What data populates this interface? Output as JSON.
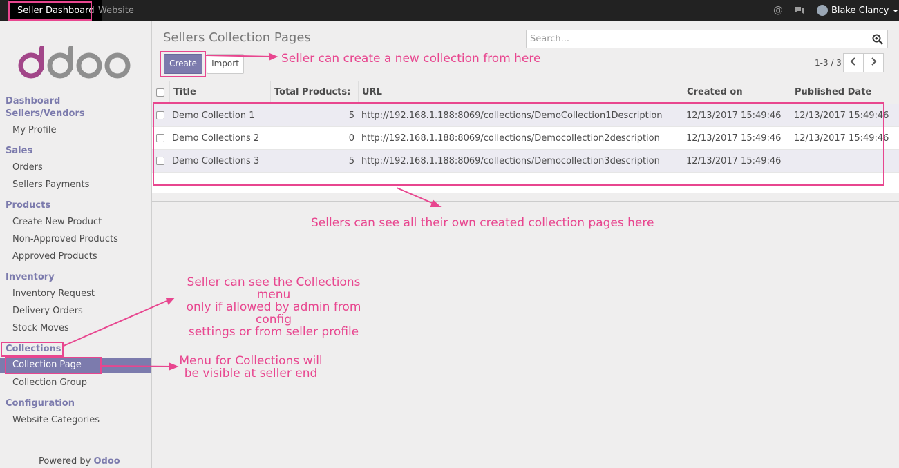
{
  "topbar": {
    "tabs": [
      "Seller Dashboard",
      "Website"
    ],
    "icons": [
      "mention-icon",
      "chat-icon"
    ],
    "user_name": "Blake Clancy"
  },
  "sidebar": {
    "logo_text": "odoo",
    "sections": [
      {
        "heading": "Dashboard"
      },
      {
        "heading": "Sellers/Vendors",
        "items": [
          "My Profile"
        ]
      },
      {
        "heading": "Sales",
        "items": [
          "Orders",
          "Sellers Payments"
        ]
      },
      {
        "heading": "Products",
        "items": [
          "Create New Product",
          "Non-Approved Products",
          "Approved Products"
        ]
      },
      {
        "heading": "Inventory",
        "items": [
          "Inventory Request",
          "Delivery Orders",
          "Stock Moves"
        ]
      },
      {
        "heading": "Collections",
        "items": [
          "Collection Page",
          "Collection Group"
        ]
      },
      {
        "heading": "Configuration",
        "items": [
          "Website Categories"
        ]
      }
    ],
    "active_item": "Collection Page",
    "powered_by": "Powered by",
    "powered_brand": "Odoo"
  },
  "main": {
    "title": "Sellers Collection Pages",
    "search_placeholder": "Search...",
    "create_label": "Create",
    "import_label": "Import",
    "pager": "1-3 / 3",
    "columns": [
      "Title",
      "Total Products:",
      "URL",
      "Created on",
      "Published Date"
    ],
    "rows": [
      {
        "title": "Demo Collection 1",
        "total": "5",
        "url": "http://192.168.1.188:8069/collections/DemoCollection1Description",
        "created": "12/13/2017 15:49:46",
        "published": "12/13/2017 15:49:46"
      },
      {
        "title": "Demo Collections 2",
        "total": "0",
        "url": "http://192.168.1.188:8069/collections/Democollection2description",
        "created": "12/13/2017 15:49:46",
        "published": "12/13/2017 15:49:46"
      },
      {
        "title": "Demo Collections 3",
        "total": "5",
        "url": "http://192.168.1.188:8069/collections/Democollection3description",
        "created": "12/13/2017 15:49:46",
        "published": ""
      }
    ]
  },
  "annotations": {
    "create_note": "Seller can create a new collection from here",
    "list_note": "Sellers can see all their own created collection pages here",
    "collections_note": [
      "Seller can see the Collections menu",
      "only if allowed by admin from config",
      "settings or from seller profile"
    ],
    "menu_note": [
      "Menu for Collections will",
      "be visible at seller end"
    ],
    "accent_color": "#e8468f"
  },
  "colors": {
    "brand": "#7c7bad",
    "topbar": "#222222"
  }
}
